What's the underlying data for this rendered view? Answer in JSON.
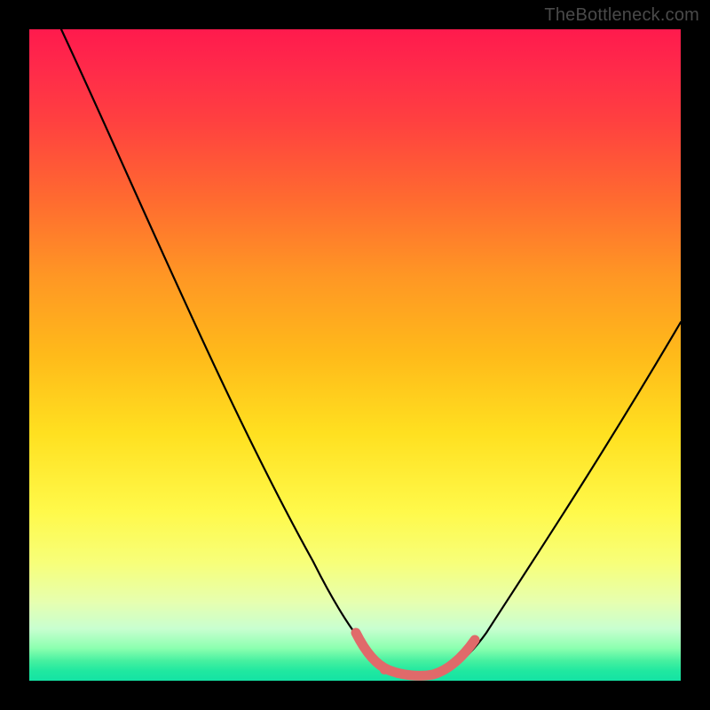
{
  "watermark": "TheBottleneck.com",
  "chart_data": {
    "type": "line",
    "title": "",
    "xlabel": "",
    "ylabel": "",
    "xlim": [
      0,
      100
    ],
    "ylim": [
      0,
      100
    ],
    "grid": false,
    "legend": false,
    "series": [
      {
        "name": "curve-black",
        "color": "#000000",
        "x": [
          5,
          10,
          15,
          20,
          25,
          30,
          35,
          40,
          45,
          50,
          53,
          55,
          57,
          59,
          61,
          63,
          65,
          70,
          75,
          80,
          85,
          90,
          95,
          100
        ],
        "values": [
          100,
          90,
          80,
          70,
          60,
          50,
          41,
          32,
          23,
          14,
          8,
          5,
          3,
          2,
          2,
          2,
          3,
          7,
          14,
          22,
          31,
          40,
          49,
          58
        ]
      },
      {
        "name": "trough-highlight-pink",
        "color": "#e06a6a",
        "x": [
          50,
          52,
          54,
          56,
          58,
          60,
          62,
          64,
          66,
          68
        ],
        "values": [
          8,
          5.5,
          3.8,
          2.8,
          2.2,
          2.0,
          2.2,
          2.8,
          4.2,
          6.2
        ]
      }
    ],
    "background_gradient": {
      "type": "vertical",
      "stops": [
        {
          "pos": 0.0,
          "color": "#ff1a4d"
        },
        {
          "pos": 0.5,
          "color": "#ffba1a"
        },
        {
          "pos": 0.8,
          "color": "#f7ff7a"
        },
        {
          "pos": 1.0,
          "color": "#14e3a4"
        }
      ]
    }
  }
}
